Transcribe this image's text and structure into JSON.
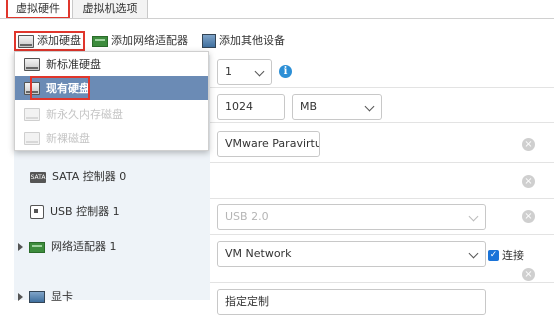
{
  "tabs": {
    "virtual_hardware": "虚拟硬件",
    "vm_options": "虚拟机选项"
  },
  "toolbar": {
    "add_hard_disk": "添加硬盘",
    "add_network_adapter": "添加网络适配器",
    "add_other_device": "添加其他设备"
  },
  "menu": {
    "items": [
      {
        "label": "新标准硬盘",
        "state": "normal"
      },
      {
        "label": "现有硬盘",
        "state": "selected"
      },
      {
        "label": "新永久内存磁盘",
        "state": "disabled"
      },
      {
        "label": "新裸磁盘",
        "state": "disabled"
      }
    ]
  },
  "fields": {
    "cpu_value": "1",
    "memory_value": "1024",
    "memory_unit": "MB",
    "scsi_value": "VMware Paravirtual",
    "usb_value": "USB 2.0",
    "network_value": "VM Network",
    "connect_label": "连接",
    "video_value": "指定定制"
  },
  "rows": {
    "sata": "SATA 控制器 0",
    "usb": "USB 控制器 1",
    "network": "网络适配器 1",
    "video": "显卡"
  },
  "icons": {
    "sata_chip": "SATA",
    "info": "i",
    "close": "×",
    "check": "✓"
  },
  "colors": {
    "highlight_border": "#e0362c",
    "menu_selected": "#6b8bb5",
    "left_panel": "#eef3f8",
    "info_blue": "#2c8fd6"
  }
}
